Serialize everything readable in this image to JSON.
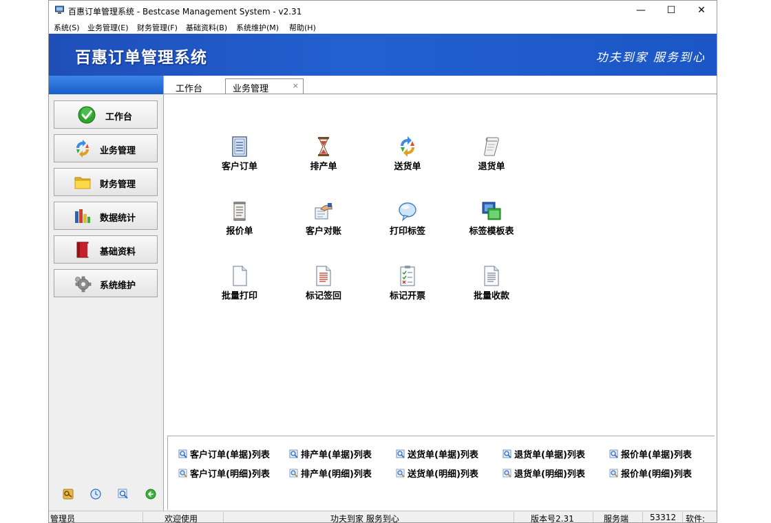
{
  "window": {
    "title": "百惠订单管理系统 - Bestcase Management System - v2.31",
    "minimize": "—",
    "maximize": "☐",
    "close": "✕"
  },
  "menu": [
    "系统(S)",
    "业务管理(E)",
    "财务管理(F)",
    "基础资料(B)",
    "系统维护(M)",
    "帮助(H)"
  ],
  "banner": {
    "title": "百惠订单管理系统",
    "slogan": "功夫到家 服务到心"
  },
  "sidebar": {
    "items": [
      {
        "label": "工作台",
        "icon": "check-circle-icon"
      },
      {
        "label": "业务管理",
        "icon": "recycle-arrows-icon"
      },
      {
        "label": "财务管理",
        "icon": "folder-icon"
      },
      {
        "label": "数据统计",
        "icon": "bar-chart-icon"
      },
      {
        "label": "基础资料",
        "icon": "book-icon"
      },
      {
        "label": "系统维护",
        "icon": "gear-icon"
      }
    ],
    "tools": [
      "key-icon",
      "clock-icon",
      "search-icon",
      "refresh-icon"
    ]
  },
  "tabs": {
    "workbench": "工作台",
    "active": "业务管理",
    "close": "×"
  },
  "functions": [
    {
      "label": "客户订单",
      "icon": "order-document-icon"
    },
    {
      "label": "排产单",
      "icon": "hourglass-icon"
    },
    {
      "label": "送货单",
      "icon": "delivery-arrows-icon"
    },
    {
      "label": "退货单",
      "icon": "scroll-icon"
    },
    {
      "label": "报价单",
      "icon": "quote-scroll-icon"
    },
    {
      "label": "客户对账",
      "icon": "handshake-icon"
    },
    {
      "label": "打印标签",
      "icon": "speech-bubble-icon"
    },
    {
      "label": "标签模板表",
      "icon": "windows-template-icon"
    },
    {
      "label": "批量打印",
      "icon": "blank-page-icon"
    },
    {
      "label": "标记签回",
      "icon": "lined-page-icon"
    },
    {
      "label": "标记开票",
      "icon": "checklist-icon"
    },
    {
      "label": "批量收款",
      "icon": "text-page-icon"
    }
  ],
  "list_links": {
    "row1": [
      "客户订单(单据)列表",
      "排产单(单据)列表",
      "送货单(单据)列表",
      "退货单(单据)列表",
      "报价单(单据)列表"
    ],
    "row2": [
      "客户订单(明细)列表",
      "排产单(明细)列表",
      "送货单(明细)列表",
      "退货单(明细)列表",
      "报价单(明细)列表"
    ]
  },
  "status": {
    "user": "管理员",
    "welcome": "欢迎使用",
    "slogan": "功夫到家 服务到心",
    "version": "版本号2.31",
    "server_label": "服务端",
    "port": "53312",
    "software": "软件:"
  }
}
